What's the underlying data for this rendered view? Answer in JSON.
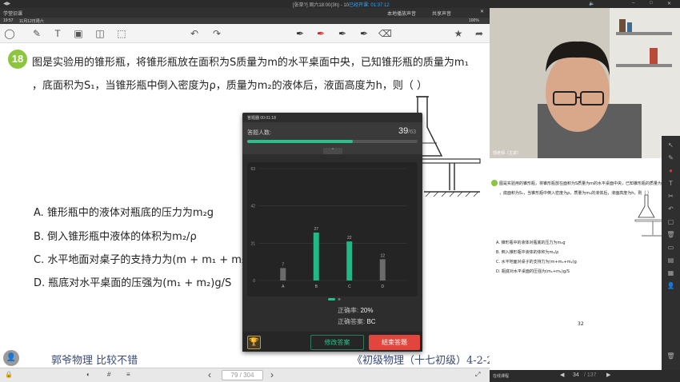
{
  "window": {
    "title": "[张草?] 周六18:00(3h) - 10",
    "status": "已经开课: 01:37:12",
    "left_meta": "学堂旧课",
    "share_audio": "本地播放声音",
    "share_button": "共享声音"
  },
  "statusbar": {
    "time": "19:57",
    "date": "11月12日周六",
    "battery": "100%"
  },
  "toolbar": {
    "icons": [
      "check-circle-icon",
      "pen-icon",
      "text-icon",
      "image-icon",
      "shapes-icon",
      "select-icon",
      "undo-icon",
      "redo-icon",
      "pen-red-icon",
      "pen-marker-icon",
      "pen-highlighter-icon",
      "pen-fine-icon",
      "eraser-icon",
      "star-icon",
      "share-icon"
    ]
  },
  "question": {
    "number": "18",
    "line1": "图是实验用的锥形瓶，将锥形瓶放在面积为S质量为m的水平桌面中央，已知锥形瓶的质量为m₁",
    "line2": "，底面积为S₁，当锥形瓶中倒入密度为ρ，质量为m₂的液体后，液面高度为h，则（     ）",
    "options": [
      "A. 锥形瓶中的液体对瓶底的压力为m₂g",
      "B. 倒入锥形瓶中液体的体积为m₂/ρ",
      "C. 水平地面对桌子的支持力为(m + m₁ + m₂)g",
      "D. 瓶底对水平桌面的压强为(m₁ + m₂)g/S"
    ]
  },
  "footer": {
    "left": "郭爷物理  比较不错",
    "right": "《初级物理（十七初级）4-2-2"
  },
  "bottombar": {
    "page_current": "79",
    "page_total": "304",
    "page_display": "79 / 304"
  },
  "panel": {
    "title": "答题器  00:01:18",
    "count_label": "答题人数:",
    "answered": "39",
    "total": "/63",
    "answered_fraction": 0.62,
    "collapse_label": "⌃",
    "accuracy_label": "正确率:",
    "accuracy_value": "20%",
    "answer_label": "正确答案:",
    "answer_value": "BC",
    "modify_button": "修改答案",
    "end_button": "结束答题"
  },
  "chart_data": {
    "type": "bar",
    "categories": [
      "A",
      "B",
      "C",
      "D"
    ],
    "values": [
      7,
      27,
      22,
      12
    ],
    "correct": [
      false,
      true,
      true,
      false
    ],
    "yticks": [
      0,
      21,
      42,
      63
    ],
    "ylim": [
      0,
      63
    ],
    "colors": {
      "correct": "#1fb984",
      "wrong": "#6b6b6b"
    }
  },
  "right_pane": {
    "speaker_name": "郭老师（主讲）",
    "mini_question": "图是实验用的锥形瓶，将锥形瓶放在面积为S质量为m的水平桌面中央，已知锥形瓶的质量为m₁",
    "mini_line2": "，底面积为S₁，当锥形瓶中倒入密度为ρ，质量为m₂的液体后，液面高度为h，则（  ）",
    "mini_options": [
      "A. 锥形瓶中的液体对瓶底的压力为m₂g",
      "B. 倒入锥形瓶中液体的体积为m₂/ρ",
      "C. 水平地面对桌子的支持力为(m+m₁+m₂)g",
      "D. 瓶底对水平桌面的压强为(m₁+m₂)g/S"
    ],
    "mini_page": "32",
    "page_current": "34",
    "page_total": "/ 137",
    "nav_label": "在线课程"
  }
}
